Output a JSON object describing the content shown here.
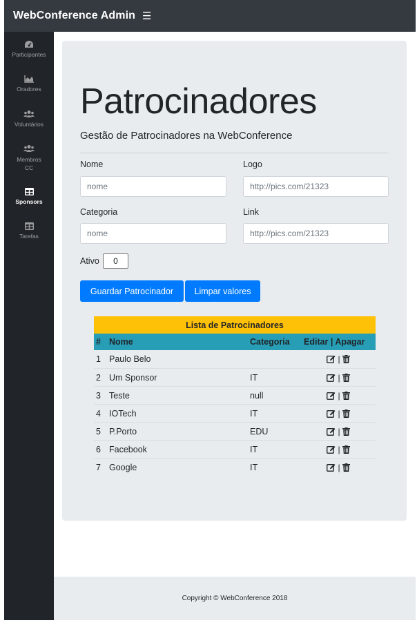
{
  "app": {
    "title": "WebConference Admin",
    "menu_icon": "hamburger-icon"
  },
  "sidebar": {
    "items": [
      {
        "label": "Participantes",
        "icon": "speedometer-icon",
        "active": false
      },
      {
        "label": "Oradores",
        "icon": "area-chart-icon",
        "active": false
      },
      {
        "label": "Voluntários",
        "icon": "users-icon",
        "active": false
      },
      {
        "label": "Membros CC",
        "icon": "users-icon",
        "active": false
      },
      {
        "label": "Sponsors",
        "icon": "table-icon",
        "active": true
      },
      {
        "label": "Tarefas",
        "icon": "table-icon",
        "active": false
      }
    ]
  },
  "main": {
    "heading": "Patrocinadores",
    "lead": "Gestão de Patrocinadores na WebConference",
    "form": {
      "nome_label": "Nome",
      "nome_placeholder": "nome",
      "logo_label": "Logo",
      "logo_placeholder": "http://pics.com/21323",
      "categoria_label": "Categoria",
      "categoria_placeholder": "nome",
      "link_label": "Link",
      "link_placeholder": "http://pics.com/21323",
      "ativo_label": "Ativo",
      "ativo_value": "0",
      "save_label": "Guardar Patrocinador",
      "clear_label": "Limpar valores"
    },
    "table": {
      "title": "Lista de Patrocinadores",
      "headers": {
        "num": "#",
        "name": "Nome",
        "category": "Categoria",
        "actions": "Editar | Apagar"
      },
      "rows": [
        {
          "num": "1",
          "name": "Paulo Belo",
          "category": ""
        },
        {
          "num": "2",
          "name": "Um Sponsor",
          "category": "IT"
        },
        {
          "num": "3",
          "name": "Teste",
          "category": "null"
        },
        {
          "num": "4",
          "name": "IOTech",
          "category": "IT"
        },
        {
          "num": "5",
          "name": "P.Porto",
          "category": "EDU"
        },
        {
          "num": "6",
          "name": "Facebook",
          "category": "IT"
        },
        {
          "num": "7",
          "name": "Google",
          "category": "IT"
        }
      ],
      "separator": "|"
    }
  },
  "footer": {
    "text": "Copyright © WebConference 2018"
  },
  "colors": {
    "primary": "#007bff",
    "warning": "#ffc107",
    "table_head": "#279eb6",
    "sidebar": "#212529",
    "topbar": "#343a40"
  }
}
